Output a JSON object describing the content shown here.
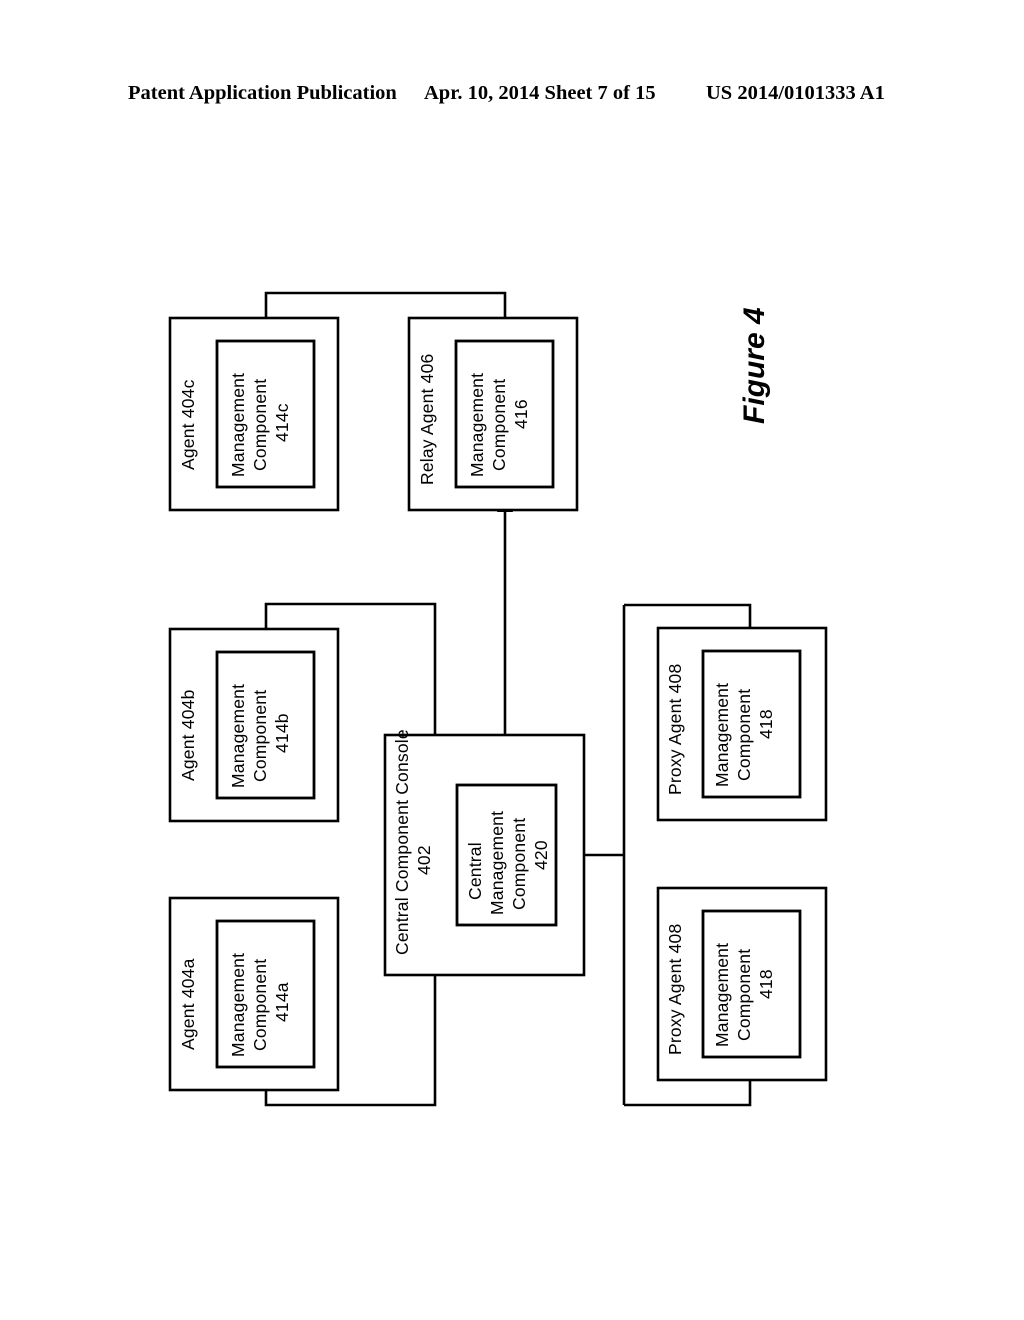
{
  "header": {
    "publication": "Patent Application Publication",
    "date_sheet": "Apr. 10, 2014  Sheet 7 of 15",
    "patent_number": "US 2014/0101333 A1"
  },
  "figure": {
    "label": "Figure 4"
  },
  "diagram": {
    "nodes": [
      {
        "id": "agent-404c",
        "outer_label": "Agent 404c",
        "inner_label_line1": "Management",
        "inner_label_line2": "Component",
        "inner_label_line3": "414c"
      },
      {
        "id": "agent-404b",
        "outer_label": "Agent 404b",
        "inner_label_line1": "Management",
        "inner_label_line2": "Component",
        "inner_label_line3": "414b"
      },
      {
        "id": "agent-404a",
        "outer_label": "Agent 404a",
        "inner_label_line1": "Management",
        "inner_label_line2": "Component",
        "inner_label_line3": "414a"
      },
      {
        "id": "relay-agent-406",
        "outer_label": "Relay Agent 406",
        "inner_label_line1": "Management",
        "inner_label_line2": "Component",
        "inner_label_line3": "416"
      },
      {
        "id": "central-component-console-402",
        "outer_label_line1": "Central Component Console",
        "outer_label_line2": "402",
        "inner_label_line1": "Central",
        "inner_label_line2": "Management",
        "inner_label_line3": "Component",
        "inner_label_line4": "420"
      },
      {
        "id": "proxy-agent-408-upper",
        "outer_label": "Proxy Agent 408",
        "inner_label_line1": "Management",
        "inner_label_line2": "Component",
        "inner_label_line3": "418"
      },
      {
        "id": "proxy-agent-408-lower",
        "outer_label": "Proxy Agent 408",
        "inner_label_line1": "Management",
        "inner_label_line2": "Component",
        "inner_label_line3": "418"
      }
    ]
  }
}
